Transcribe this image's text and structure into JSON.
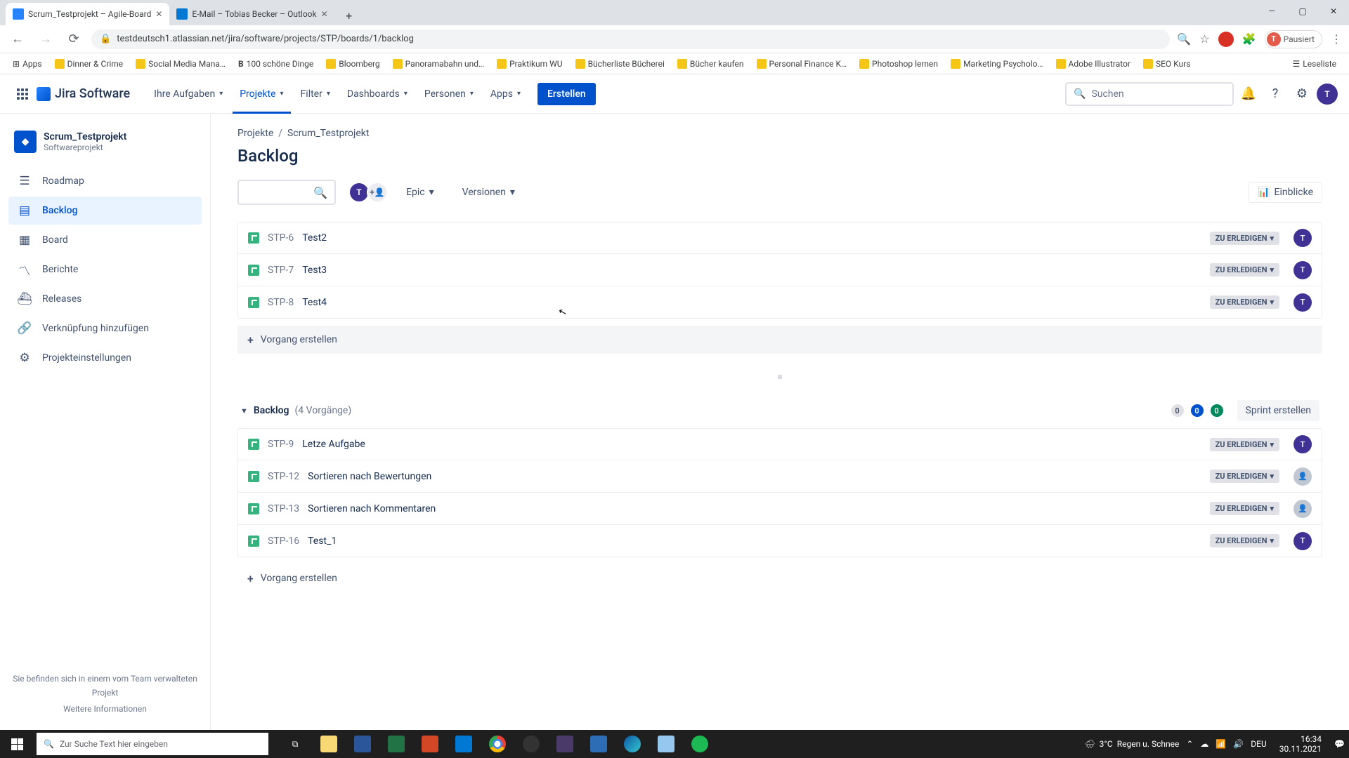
{
  "browser": {
    "tabs": [
      {
        "title": "Scrum_Testprojekt – Agile-Board",
        "favicon": "fav-blue"
      },
      {
        "title": "E-Mail – Tobias Becker – Outlook",
        "favicon": "fav-outlook"
      }
    ],
    "url": "testdeutsch1.atlassian.net/jira/software/projects/STP/boards/1/backlog",
    "paused_label": "Pausiert",
    "paused_initial": "T"
  },
  "bookmarks": [
    "Apps",
    "Dinner & Crime",
    "Social Media Mana…",
    "100 schöne Dinge",
    "Bloomberg",
    "Panoramabahn und…",
    "Praktikum WU",
    "Bücherliste Bücherei",
    "Bücher kaufen",
    "Personal Finance K…",
    "Photoshop lernen",
    "Marketing Psycholo…",
    "Adobe Illustrator",
    "SEO Kurs"
  ],
  "bookmarks_right": "Leseliste",
  "jira": {
    "logo_text": "Jira Software",
    "nav": {
      "your_work": "Ihre Aufgaben",
      "projects": "Projekte",
      "filters": "Filter",
      "dashboards": "Dashboards",
      "people": "Personen",
      "apps": "Apps"
    },
    "create_label": "Erstellen",
    "search_placeholder": "Suchen",
    "avatar_initial": "T"
  },
  "sidebar": {
    "project_name": "Scrum_Testprojekt",
    "project_type": "Softwareprojekt",
    "items": {
      "roadmap": "Roadmap",
      "backlog": "Backlog",
      "board": "Board",
      "reports": "Berichte",
      "releases": "Releases",
      "shortcut": "Verknüpfung hinzufügen",
      "settings": "Projekteinstellungen"
    },
    "footer_line": "Sie befinden sich in einem vom Team verwalteten Projekt",
    "footer_link": "Weitere Informationen"
  },
  "content": {
    "breadcrumb_projects": "Projekte",
    "breadcrumb_project": "Scrum_Testprojekt",
    "page_title": "Backlog",
    "filter_epic": "Epic",
    "filter_versions": "Versionen",
    "insights_label": "Einblicke",
    "status_label": "ZU ERLEDIGEN",
    "create_issue_label": "Vorgang erstellen",
    "sprint_issues": [
      {
        "key": "STP-6",
        "title": "Test2",
        "assigned": true
      },
      {
        "key": "STP-7",
        "title": "Test3",
        "assigned": true
      },
      {
        "key": "STP-8",
        "title": "Test4",
        "assigned": true
      }
    ],
    "backlog_header": {
      "title": "Backlog",
      "count": "(4 Vorgänge)",
      "pills": {
        "gray": "0",
        "blue": "0",
        "green": "0"
      },
      "create_sprint": "Sprint erstellen"
    },
    "backlog_issues": [
      {
        "key": "STP-9",
        "title": "Letze Aufgabe",
        "assigned": true
      },
      {
        "key": "STP-12",
        "title": "Sortieren nach Bewertungen",
        "assigned": false
      },
      {
        "key": "STP-13",
        "title": "Sortieren nach Kommentaren",
        "assigned": false
      },
      {
        "key": "STP-16",
        "title": "Test_1",
        "assigned": true
      }
    ]
  },
  "taskbar": {
    "search_placeholder": "Zur Suche Text hier eingeben",
    "weather_temp": "3°C",
    "weather_text": "Regen u. Schnee",
    "time": "16:34",
    "date": "30.11.2021",
    "lang": "DEU"
  }
}
